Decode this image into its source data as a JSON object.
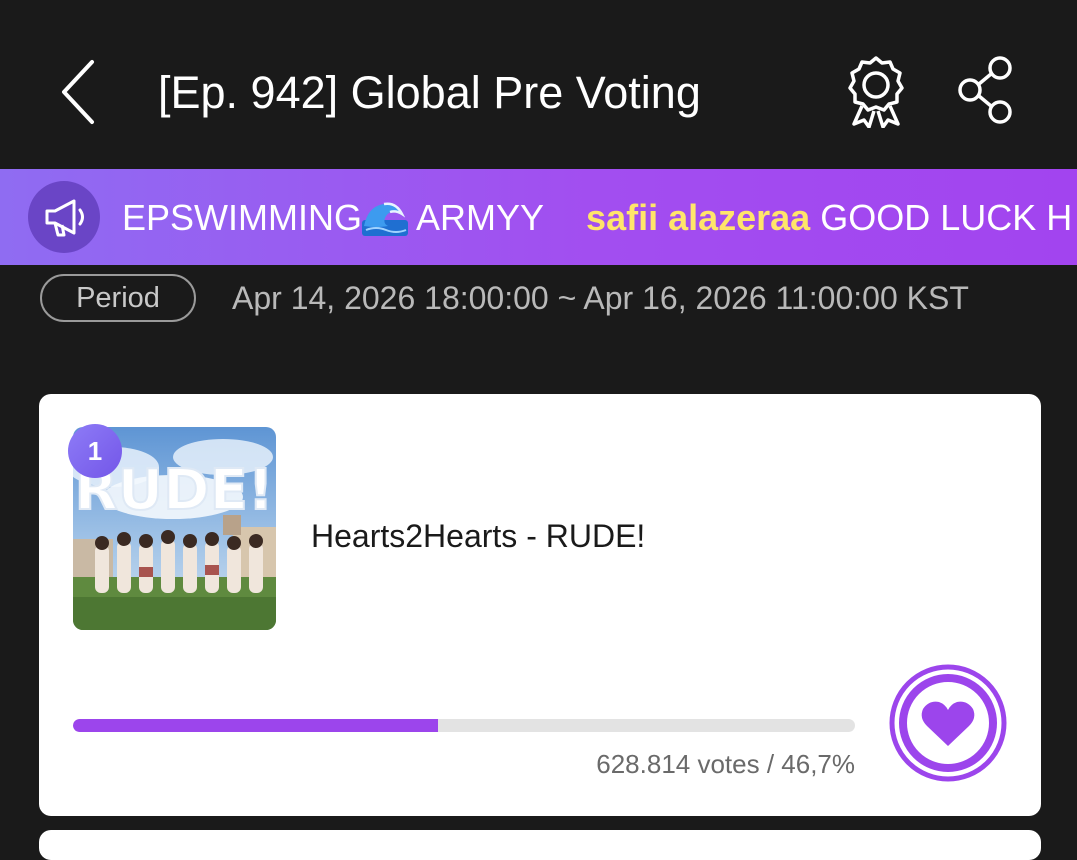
{
  "header": {
    "title": "[Ep. 942] Global Pre Voting",
    "back_icon": "chevron-left-icon",
    "award_icon": "award-ribbon-icon",
    "share_icon": "share-icon"
  },
  "banner": {
    "icon": "megaphone-icon",
    "message_1": "EPSWIMMING",
    "emoji": "wave-emoji",
    "message_1_suffix": " ARMYY",
    "sender": "safii alazeraa",
    "message_2": " GOOD LUCK H",
    "colors": {
      "start": "#8f6cf2",
      "end": "#a244ef",
      "sender": "#ffe56a"
    }
  },
  "period": {
    "label": "Period",
    "range": "Apr 14, 2026 18:00:00 ~ Apr 16, 2026 11:00:00 KST"
  },
  "entries": [
    {
      "rank": "1",
      "title": "Hearts2Hearts - RUDE!",
      "album_art_text": "RUDE!",
      "votes_label": "628.814 votes / 46,7%",
      "vote_percent": 46.7,
      "vote_icon": "heart-icon",
      "accent": "#9c45ec"
    }
  ]
}
